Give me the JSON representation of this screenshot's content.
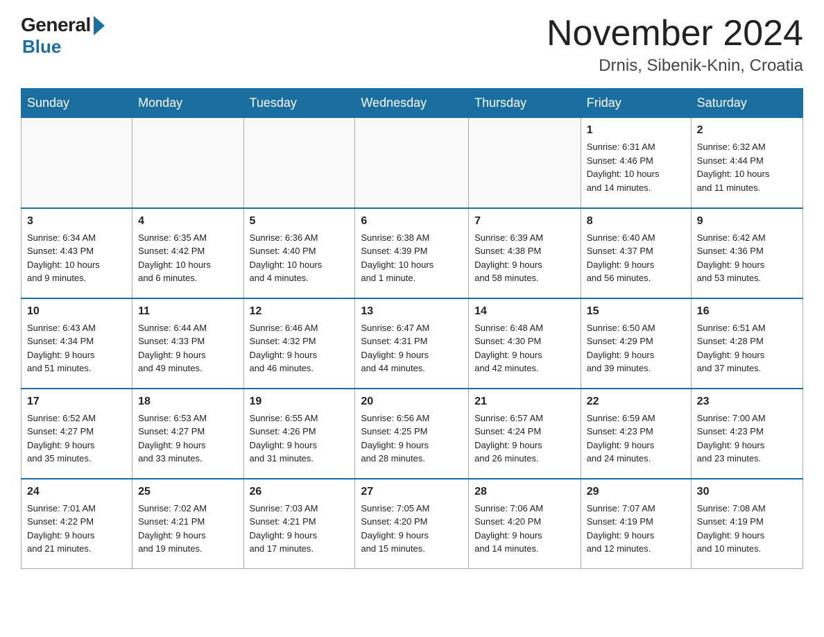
{
  "header": {
    "logo_general": "General",
    "logo_blue": "Blue",
    "month_title": "November 2024",
    "location": "Drnis, Sibenik-Knin, Croatia"
  },
  "days_of_week": [
    "Sunday",
    "Monday",
    "Tuesday",
    "Wednesday",
    "Thursday",
    "Friday",
    "Saturday"
  ],
  "weeks": [
    [
      {
        "day": "",
        "info": ""
      },
      {
        "day": "",
        "info": ""
      },
      {
        "day": "",
        "info": ""
      },
      {
        "day": "",
        "info": ""
      },
      {
        "day": "",
        "info": ""
      },
      {
        "day": "1",
        "info": "Sunrise: 6:31 AM\nSunset: 4:46 PM\nDaylight: 10 hours\nand 14 minutes."
      },
      {
        "day": "2",
        "info": "Sunrise: 6:32 AM\nSunset: 4:44 PM\nDaylight: 10 hours\nand 11 minutes."
      }
    ],
    [
      {
        "day": "3",
        "info": "Sunrise: 6:34 AM\nSunset: 4:43 PM\nDaylight: 10 hours\nand 9 minutes."
      },
      {
        "day": "4",
        "info": "Sunrise: 6:35 AM\nSunset: 4:42 PM\nDaylight: 10 hours\nand 6 minutes."
      },
      {
        "day": "5",
        "info": "Sunrise: 6:36 AM\nSunset: 4:40 PM\nDaylight: 10 hours\nand 4 minutes."
      },
      {
        "day": "6",
        "info": "Sunrise: 6:38 AM\nSunset: 4:39 PM\nDaylight: 10 hours\nand 1 minute."
      },
      {
        "day": "7",
        "info": "Sunrise: 6:39 AM\nSunset: 4:38 PM\nDaylight: 9 hours\nand 58 minutes."
      },
      {
        "day": "8",
        "info": "Sunrise: 6:40 AM\nSunset: 4:37 PM\nDaylight: 9 hours\nand 56 minutes."
      },
      {
        "day": "9",
        "info": "Sunrise: 6:42 AM\nSunset: 4:36 PM\nDaylight: 9 hours\nand 53 minutes."
      }
    ],
    [
      {
        "day": "10",
        "info": "Sunrise: 6:43 AM\nSunset: 4:34 PM\nDaylight: 9 hours\nand 51 minutes."
      },
      {
        "day": "11",
        "info": "Sunrise: 6:44 AM\nSunset: 4:33 PM\nDaylight: 9 hours\nand 49 minutes."
      },
      {
        "day": "12",
        "info": "Sunrise: 6:46 AM\nSunset: 4:32 PM\nDaylight: 9 hours\nand 46 minutes."
      },
      {
        "day": "13",
        "info": "Sunrise: 6:47 AM\nSunset: 4:31 PM\nDaylight: 9 hours\nand 44 minutes."
      },
      {
        "day": "14",
        "info": "Sunrise: 6:48 AM\nSunset: 4:30 PM\nDaylight: 9 hours\nand 42 minutes."
      },
      {
        "day": "15",
        "info": "Sunrise: 6:50 AM\nSunset: 4:29 PM\nDaylight: 9 hours\nand 39 minutes."
      },
      {
        "day": "16",
        "info": "Sunrise: 6:51 AM\nSunset: 4:28 PM\nDaylight: 9 hours\nand 37 minutes."
      }
    ],
    [
      {
        "day": "17",
        "info": "Sunrise: 6:52 AM\nSunset: 4:27 PM\nDaylight: 9 hours\nand 35 minutes."
      },
      {
        "day": "18",
        "info": "Sunrise: 6:53 AM\nSunset: 4:27 PM\nDaylight: 9 hours\nand 33 minutes."
      },
      {
        "day": "19",
        "info": "Sunrise: 6:55 AM\nSunset: 4:26 PM\nDaylight: 9 hours\nand 31 minutes."
      },
      {
        "day": "20",
        "info": "Sunrise: 6:56 AM\nSunset: 4:25 PM\nDaylight: 9 hours\nand 28 minutes."
      },
      {
        "day": "21",
        "info": "Sunrise: 6:57 AM\nSunset: 4:24 PM\nDaylight: 9 hours\nand 26 minutes."
      },
      {
        "day": "22",
        "info": "Sunrise: 6:59 AM\nSunset: 4:23 PM\nDaylight: 9 hours\nand 24 minutes."
      },
      {
        "day": "23",
        "info": "Sunrise: 7:00 AM\nSunset: 4:23 PM\nDaylight: 9 hours\nand 23 minutes."
      }
    ],
    [
      {
        "day": "24",
        "info": "Sunrise: 7:01 AM\nSunset: 4:22 PM\nDaylight: 9 hours\nand 21 minutes."
      },
      {
        "day": "25",
        "info": "Sunrise: 7:02 AM\nSunset: 4:21 PM\nDaylight: 9 hours\nand 19 minutes."
      },
      {
        "day": "26",
        "info": "Sunrise: 7:03 AM\nSunset: 4:21 PM\nDaylight: 9 hours\nand 17 minutes."
      },
      {
        "day": "27",
        "info": "Sunrise: 7:05 AM\nSunset: 4:20 PM\nDaylight: 9 hours\nand 15 minutes."
      },
      {
        "day": "28",
        "info": "Sunrise: 7:06 AM\nSunset: 4:20 PM\nDaylight: 9 hours\nand 14 minutes."
      },
      {
        "day": "29",
        "info": "Sunrise: 7:07 AM\nSunset: 4:19 PM\nDaylight: 9 hours\nand 12 minutes."
      },
      {
        "day": "30",
        "info": "Sunrise: 7:08 AM\nSunset: 4:19 PM\nDaylight: 9 hours\nand 10 minutes."
      }
    ]
  ]
}
